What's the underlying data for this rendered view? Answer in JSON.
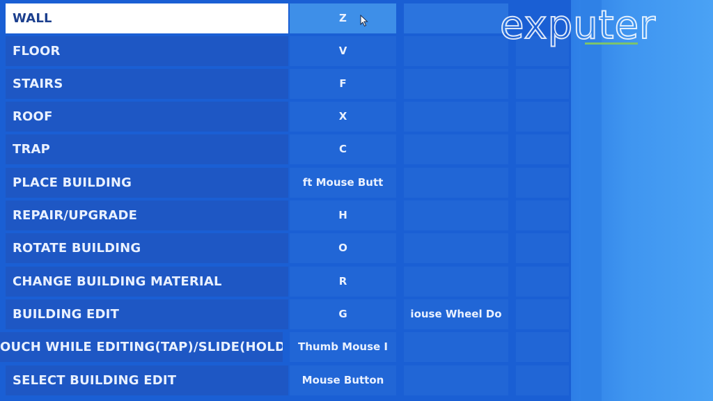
{
  "logo": "exputer",
  "rows": [
    {
      "label": "WALL",
      "key1": "Z",
      "key2": "",
      "active": true
    },
    {
      "label": "FLOOR",
      "key1": "V",
      "key2": ""
    },
    {
      "label": "STAIRS",
      "key1": "F",
      "key2": ""
    },
    {
      "label": "ROOF",
      "key1": "X",
      "key2": ""
    },
    {
      "label": "TRAP",
      "key1": "C",
      "key2": ""
    },
    {
      "label": "PLACE BUILDING",
      "key1": "ft Mouse Butt",
      "key2": ""
    },
    {
      "label": "REPAIR/UPGRADE",
      "key1": "H",
      "key2": ""
    },
    {
      "label": "ROTATE BUILDING",
      "key1": "O",
      "key2": ""
    },
    {
      "label": "CHANGE BUILDING MATERIAL",
      "key1": "R",
      "key2": ""
    },
    {
      "label": "BUILDING EDIT",
      "key1": "G",
      "key2": "iouse Wheel Do"
    },
    {
      "label": "ROUCH WHILE EDITING(TAP)/SLIDE(HOLD)",
      "key1": "Thumb Mouse I",
      "key2": ""
    },
    {
      "label": "SELECT BUILDING EDIT",
      "key1": "Mouse Button",
      "key2": ""
    }
  ],
  "colors": {
    "panel": "#1a5fd4",
    "cell": "#2166d6",
    "active_label": "#ffffff",
    "clear_icon": "#e0456a"
  }
}
